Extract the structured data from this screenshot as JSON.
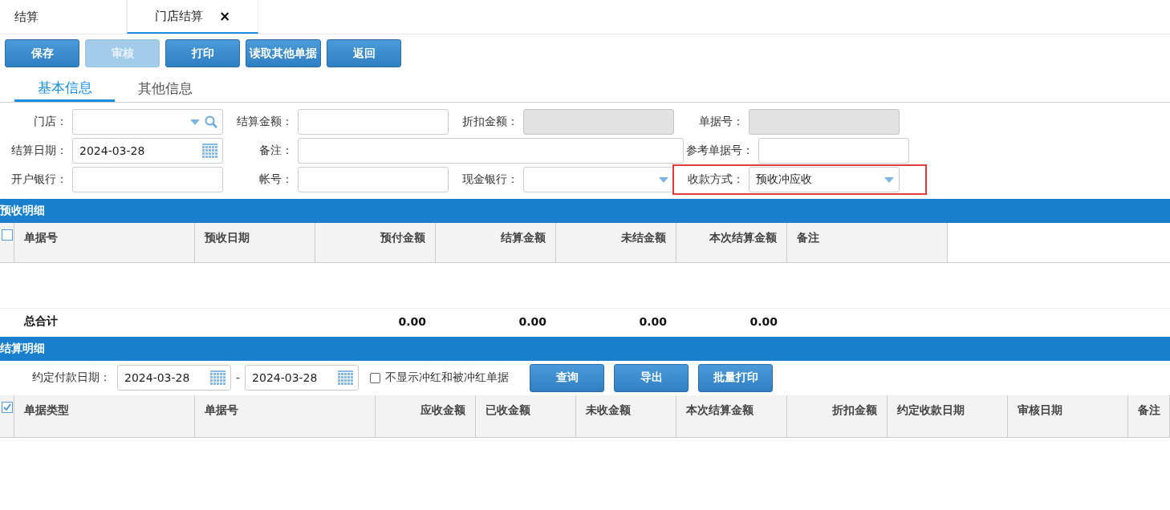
{
  "tabs": [
    {
      "label": "结算",
      "selected": false
    },
    {
      "label": "门店结算",
      "selected": true,
      "close": "×"
    }
  ],
  "toolbar": [
    {
      "label": "保存",
      "disabled": false
    },
    {
      "label": "审核",
      "disabled": true
    },
    {
      "label": "打印",
      "disabled": false
    },
    {
      "label": "读取其他单据",
      "disabled": false
    },
    {
      "label": "返回",
      "disabled": false
    }
  ],
  "form_tabs": [
    {
      "label": "基本信息",
      "selected": true
    },
    {
      "label": "其他信息",
      "selected": false
    }
  ],
  "form_rows": [
    [
      {
        "label": "门店：",
        "kind": "lookup",
        "disabled": false,
        "highlighted": false
      },
      {
        "label": "结算金额：",
        "kind": "text",
        "disabled": false,
        "highlighted": false
      },
      {
        "label": "折扣金额：",
        "kind": "text",
        "disabled": true,
        "highlighted": false
      },
      {
        "label": "单据号：",
        "kind": "text",
        "disabled": true,
        "highlighted": false
      }
    ],
    [
      {
        "label": "结算日期：",
        "kind": "date",
        "value": "2024-03-28",
        "disabled": false,
        "highlighted": false
      },
      {
        "label": "备注：",
        "kind": "wide",
        "disabled": false,
        "highlighted": false
      },
      {
        "label": "参考单据号：",
        "kind": "text",
        "disabled": false,
        "highlighted": false
      }
    ],
    [
      {
        "label": "开户银行：",
        "kind": "text",
        "disabled": false,
        "highlighted": false
      },
      {
        "label": "帐号：",
        "kind": "text",
        "disabled": false,
        "highlighted": false
      },
      {
        "label": "现金银行：",
        "kind": "select",
        "disabled": false,
        "highlighted": false
      },
      {
        "label": "收款方式：",
        "kind": "select",
        "value": "预收冲应收",
        "disabled": false,
        "highlighted": true
      }
    ]
  ],
  "advance_section": {
    "title": "预收明细",
    "select_all_checked": false,
    "columns": [
      "单据号",
      "预收日期",
      "预付金额",
      "结算金额",
      "未结金额",
      "本次结算金额",
      "备注"
    ],
    "totals": {
      "label": "总合计",
      "values": [
        "0.00",
        "0.00",
        "0.00",
        "0.00"
      ]
    }
  },
  "settlement_section": {
    "title": "结算明细",
    "filter": {
      "label": "约定付款日期：",
      "from": "2024-03-28",
      "separator": "-",
      "to": "2024-03-28",
      "checkbox": {
        "label": "不显示冲红和被冲红单据",
        "checked": false
      },
      "buttons": [
        "查询",
        "导出",
        "批量打印"
      ]
    },
    "select_all_checked": true,
    "columns": [
      "单据类型",
      "单据号",
      "应收金额",
      "已收金额",
      "未收金额",
      "本次结算金额",
      "折扣金额",
      "约定收款日期",
      "审核日期",
      "备注"
    ]
  }
}
